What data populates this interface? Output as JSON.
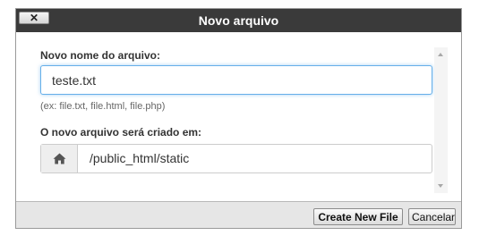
{
  "dialog": {
    "title": "Novo arquivo",
    "close_label": "✕"
  },
  "form": {
    "filename_label": "Novo nome do arquivo:",
    "filename_value": "teste.txt",
    "filename_hint": "(ex: file.txt, file.html, file.php)",
    "location_label": "O novo arquivo será criado em:",
    "location_icon": "home-icon",
    "location_value": "/public_html/static"
  },
  "footer": {
    "create_label": "Create New File",
    "cancel_label": "Cancelar"
  },
  "colors": {
    "titlebar": "#3a3a3a",
    "focus_border": "#66afe9",
    "footer_bg": "#e6e6e6"
  }
}
